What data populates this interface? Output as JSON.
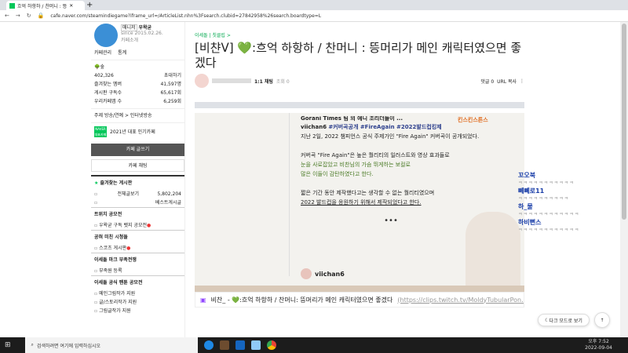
{
  "browser": {
    "tab_title": "흐억 하항하 / 찬머니 : 뜽",
    "url": "cafe.naver.com/steamindiegame?iframe_url=/ArticleList.nhn%3Fsearch.clubid=27842958%26search.boardtype=L"
  },
  "sidebar": {
    "manager_badge": "매니저",
    "manager": "우왁굳",
    "since": "since 2015.02.26.",
    "cafe_intro": "카페소개",
    "manage": "카페관리",
    "stats": "통계",
    "level": "숲",
    "members": "402,326",
    "invite": "초대하기",
    "fav_members_label": "즐겨찾는 멤버",
    "fav_members": "41,597명",
    "board_subs_label": "게시판 구독수",
    "board_subs": "65,617회",
    "cafe_app_label": "우리카페앱 수",
    "cafe_app": "6,259회",
    "topic": "주제 방송/연예 > 인터넷방송",
    "naver_badge": "NAVER 대표카페",
    "award": "2021년 대표 인기카페",
    "write_btn": "카페 글쓰기",
    "chat_btn": "카페 채팅",
    "fav_boards": "즐겨찾는 게시판",
    "all_posts": "전체글보기",
    "all_count": "5,802,204",
    "best": "베스트게시글",
    "sections": [
      {
        "title": "트위치 공모전",
        "items": [
          "우왁굳 구독 뱃지 공모전"
        ]
      },
      {
        "title": "공혀 미친 시청들",
        "items": [
          "스코츠 게시판"
        ]
      },
      {
        "title": "이세돌 마크 부족전쟁",
        "items": [
          "부족원 등록"
        ]
      },
      {
        "title": "이세돌 공식 팬툰 공모전",
        "items": [
          "메인그림작가 지원",
          "글/스토리작가 지원",
          "그림글작가 지원"
        ]
      }
    ]
  },
  "article": {
    "breadcrumb": "이세돌 | 칫클립 >",
    "title": "[비챤ᐯ] 💚:흐억 하항하 / 찬머니 : 뜽머리가 메인 캐릭터였으면 좋겠다",
    "author_badge": "1:1 채팅",
    "views": "조회 0",
    "comments": "댓글 0",
    "url_copy": "URL 복사"
  },
  "video": {
    "line0": "Gorani Times 팀 의 에니 조리더들이 ...",
    "user": "viichan6",
    "tags": "#커버곡공개 #FireAgain #2022발드컵킹제",
    "p1": "지난 2일, 2022 챔피언스 공식 주제가인 \"Fire Again\" 커버곡이 공개되었다.",
    "p2a": "커버곡 \"Fire Again\"은 높은 퀄리티의 일러스트와 영상 효과들로",
    "p2b": "눈을 사로잡았고 비찬님의 가슴 뛰게하는 보컬로",
    "p2c": "많은 이들이 감탄하였다고 한다.",
    "p3a": "짧은 기간 동안 제작했다고는 생각할 수 없는 퀄리티였으며",
    "p3b": "2022 발드컵을 응원하기 위해서 제작되었다고 한다.",
    "dots": "•••",
    "stream_label": "킨스킨스튼스",
    "author": "viichan6"
  },
  "caption": {
    "text": "비찬_ - 💚:흐억 하항하 / 찬머니: 뜽머리가 메인 캐릭터였으면 좋겠다",
    "link": "(https://clips.twitch.tv/MoldyTubularPon…"
  },
  "chat": [
    {
      "name": "꼬오북",
      "msg": "ㅋㅋㅋㅋㅋㅋㅋㅋㅋㅋㅋ"
    },
    {
      "name": "뻬뻬로11",
      "msg": "ㅋㅋㅋㅋㅋㅋㅋㅋㅋㅋ"
    },
    {
      "name": "하_물",
      "msg": "ㅋㅋㅋㅋㅋㅋㅋㅋㅋㅋㅋㅋ"
    },
    {
      "name": "하비뻔스",
      "msg": "ㅋㅋㅋㅋㅋㅋㅋㅋㅋㅋㅋㅋ"
    }
  ],
  "float": {
    "dark_mode": "다크 모드로 보기",
    "top": "↑"
  },
  "taskbar": {
    "search": "검색하려면 여기에 입력하십시오",
    "time": "오후 7:52",
    "date": "2022-09-04"
  }
}
